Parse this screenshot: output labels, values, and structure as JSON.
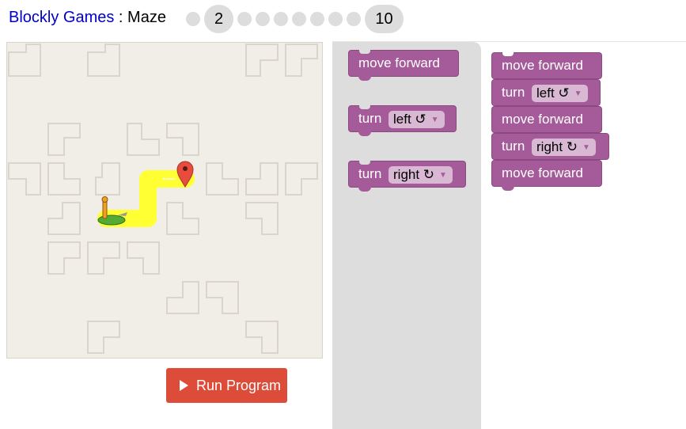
{
  "header": {
    "app_name": "Blockly Games",
    "separator": " : ",
    "game": "Maze"
  },
  "levels": {
    "current": "2",
    "last": "10"
  },
  "run_button": {
    "label": "Run Program"
  },
  "toolbox": {
    "blocks": [
      {
        "type": "move",
        "text": "move forward"
      },
      {
        "type": "turn",
        "text": "turn",
        "option": "left ↺"
      },
      {
        "type": "turn",
        "text": "turn",
        "option": "right ↻"
      }
    ]
  },
  "program": {
    "blocks": [
      {
        "type": "move",
        "text": "move forward"
      },
      {
        "type": "turn",
        "text": "turn",
        "option": "left ↺"
      },
      {
        "type": "move",
        "text": "move forward"
      },
      {
        "type": "turn",
        "text": "turn",
        "option": "right ↻"
      },
      {
        "type": "move",
        "text": "move forward"
      }
    ]
  },
  "colors": {
    "block": "#a55b99",
    "path": "#ffff33",
    "run_button": "#dd4b39",
    "marker": "#e74c3c"
  },
  "icons": {
    "start": "pegman-figure-icon",
    "finish": "map-marker-icon",
    "run": "play-triangle-icon",
    "turn_left": "rotate-left-icon",
    "turn_right": "rotate-right-icon"
  }
}
